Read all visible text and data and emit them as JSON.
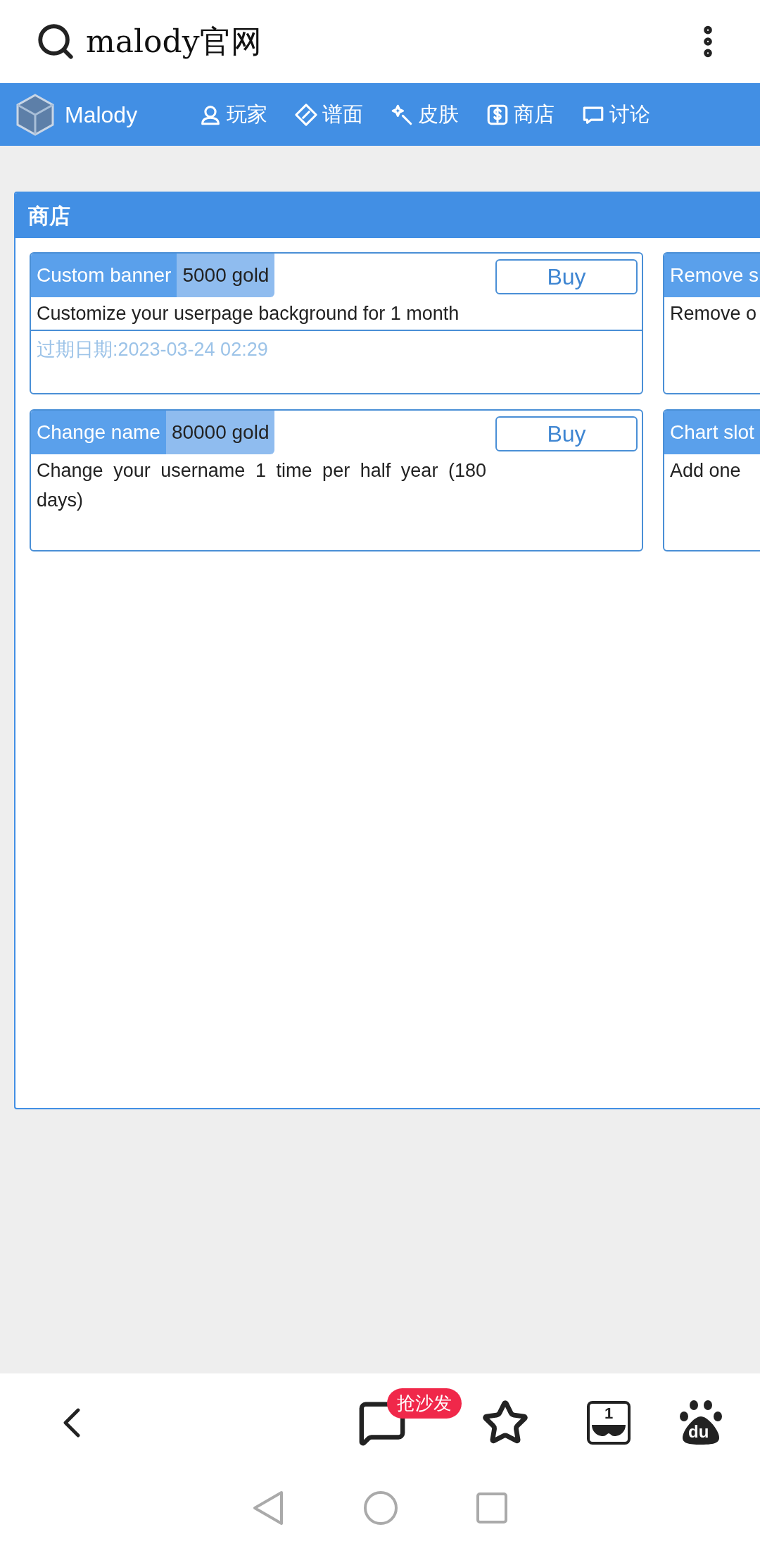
{
  "search_bar": {
    "query": "malody官网"
  },
  "site_nav": {
    "brand": "Malody",
    "items": [
      {
        "label": "玩家",
        "kind": "user"
      },
      {
        "label": "谱面",
        "kind": "chart"
      },
      {
        "label": "皮肤",
        "kind": "wand"
      },
      {
        "label": "商店",
        "kind": "dollar"
      },
      {
        "label": "讨论",
        "kind": "chat"
      }
    ]
  },
  "shop": {
    "title": "商店",
    "items": [
      {
        "name": "Custom banner",
        "price": "5000 gold",
        "button": "Buy",
        "description": "Customize your userpage background for 1 month",
        "expiry": "过期日期:2023-03-24 02:29"
      },
      {
        "name": "Remove s",
        "description": "Remove o"
      },
      {
        "name": "Change name",
        "price": "80000 gold",
        "button": "Buy",
        "description": "Change your username 1 time per half year (180 days)"
      },
      {
        "name": "Chart slot",
        "description": "Add one"
      }
    ]
  },
  "browser_toolbar": {
    "comment_badge": "抢沙发",
    "tab_count": "1",
    "logo_text": "du"
  }
}
